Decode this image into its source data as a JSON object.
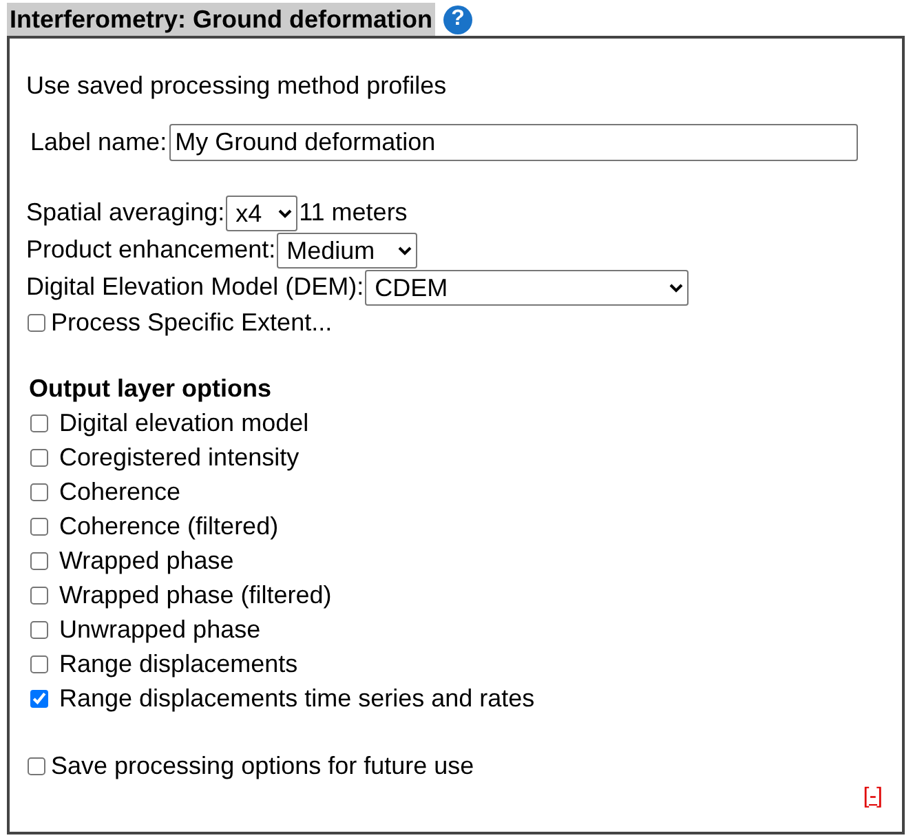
{
  "header": {
    "title": "Interferometry: Ground deformation",
    "help": "?"
  },
  "profiles_link": "Use saved processing method profiles",
  "label_field": {
    "label": "Label name:",
    "value": "My Ground deformation"
  },
  "settings": [
    {
      "label": "Spatial averaging:",
      "value": "x4",
      "note": "11 meters"
    },
    {
      "label": "Product enhancement:",
      "value": "Medium"
    },
    {
      "label": "Digital Elevation Model (DEM):",
      "value": "CDEM"
    }
  ],
  "extent": {
    "label": "Process Specific Extent...",
    "checked": false
  },
  "output_layers": {
    "heading": "Output layer options",
    "items": [
      {
        "label": "Digital elevation model",
        "checked": false
      },
      {
        "label": "Coregistered intensity",
        "checked": false
      },
      {
        "label": "Coherence",
        "checked": false
      },
      {
        "label": "Coherence (filtered)",
        "checked": false
      },
      {
        "label": "Wrapped phase",
        "checked": false
      },
      {
        "label": "Wrapped phase (filtered)",
        "checked": false
      },
      {
        "label": "Unwrapped phase",
        "checked": false
      },
      {
        "label": "Range displacements",
        "checked": false
      },
      {
        "label": "Range displacements time series and rates",
        "checked": true
      }
    ]
  },
  "save_option": {
    "label": "Save processing options for future use",
    "checked": false
  },
  "collapse_link": "[-]"
}
